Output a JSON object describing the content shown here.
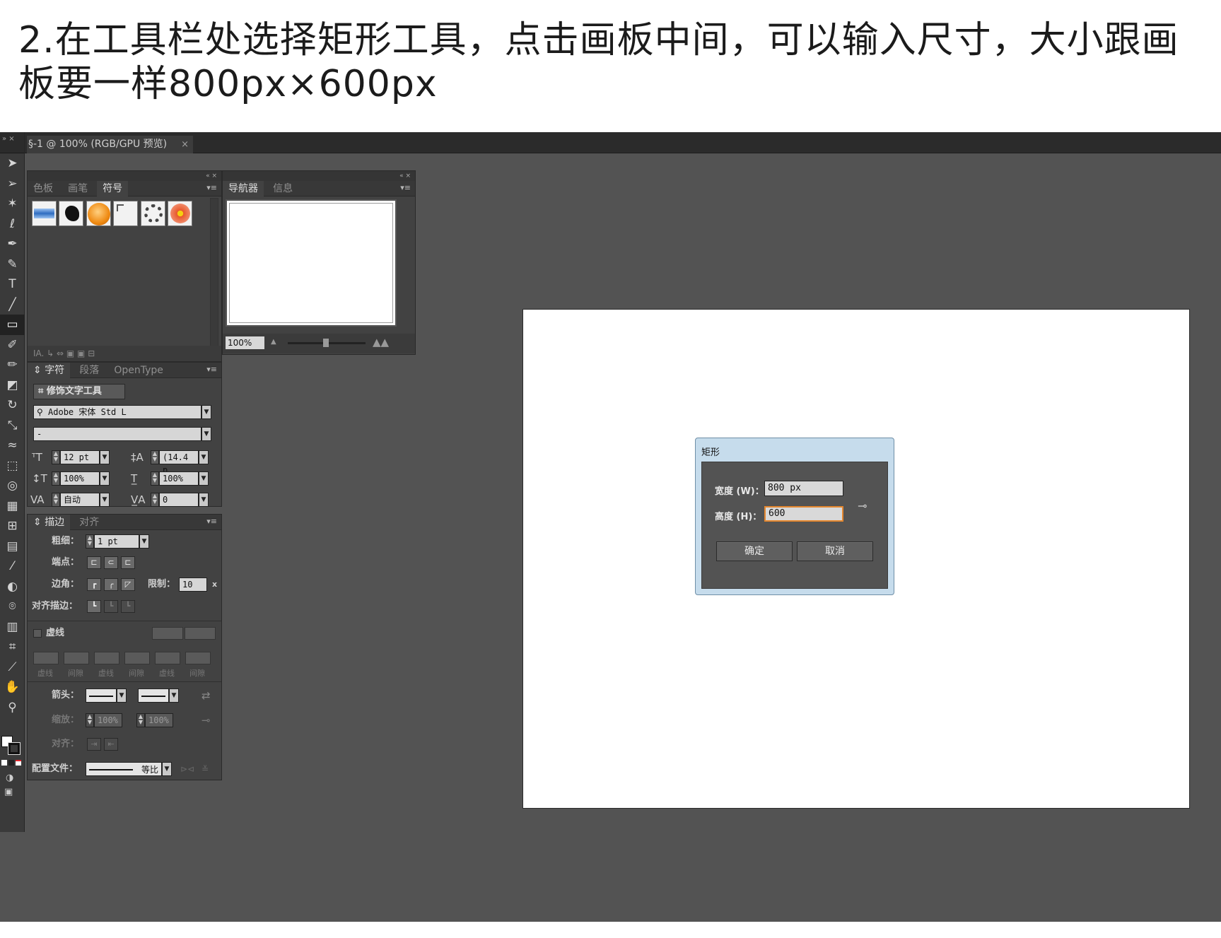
{
  "caption": {
    "line1": "2.在工具栏处选择矩形工具，点击画板中间，可以输入尺寸，大小跟画",
    "line2": "板要一样800px×600px"
  },
  "document": {
    "tab_title": "§-1 @ 100% (RGB/GPU 预览)",
    "tab_close": "×"
  },
  "tools_panel": {
    "header": "»  ×",
    "items": [
      "selection-tool",
      "direct-selection-tool",
      "magic-wand-tool",
      "lasso-tool",
      "pen-tool",
      "curvature-tool",
      "type-tool",
      "line-tool",
      "rectangle-tool",
      "paintbrush-tool",
      "pencil-tool",
      "eraser-tool",
      "rotate-tool",
      "scale-tool",
      "width-tool",
      "free-transform-tool",
      "shape-builder-tool",
      "perspective-grid-tool",
      "mesh-tool",
      "gradient-tool",
      "eyedropper-tool",
      "blend-tool",
      "symbol-sprayer-tool",
      "column-graph-tool",
      "artboard-tool",
      "slice-tool",
      "hand-tool",
      "zoom-tool"
    ],
    "selected": "rectangle-tool"
  },
  "swatch_panel": {
    "tabs": [
      "色板",
      "画笔",
      "符号"
    ],
    "active_tab": "符号",
    "menu": "▾≡",
    "footer": "IA.   ↳  ⇔  ▣  ▣  ⊟"
  },
  "navigator_panel": {
    "tabs": [
      "导航器",
      "信息"
    ],
    "active_tab": "导航器",
    "menu": "▾≡",
    "zoom": "100%"
  },
  "character_panel": {
    "tabs": [
      "字符",
      "段落",
      "OpenType"
    ],
    "active_tab": "字符",
    "menu": "▾≡",
    "touch_type_button": "修饰文字工具",
    "font_family": "Adobe 宋体 Std L",
    "font_style": "-",
    "font_size": "12 pt",
    "leading": "(14.4 p",
    "vertical_scale": "100%",
    "horizontal_scale": "100%",
    "kerning": "自动",
    "tracking": "0"
  },
  "stroke_panel": {
    "tabs": [
      "描边",
      "对齐"
    ],
    "active_tab": "描边",
    "menu": "▾≡",
    "weight_label": "粗细：",
    "weight": "1 pt",
    "cap_label": "端点：",
    "corner_label": "边角：",
    "limit_label": "限制：",
    "limit": "10",
    "limit_unit": "x",
    "align_label": "对齐描边：",
    "dashed_label": "虚线",
    "dash_labels": [
      "虚线",
      "间隙",
      "虚线",
      "间隙",
      "虚线",
      "间隙"
    ],
    "arrowheads_label": "箭头：",
    "scale_label": "缩放：",
    "scale_start": "100%",
    "scale_end": "100%",
    "align_arrows_label": "对齐：",
    "profile_label": "配置文件：",
    "profile_value": "等比"
  },
  "rectangle_dialog": {
    "title": "矩形",
    "width_label": "宽度 (W)：",
    "width_value": "800 px",
    "height_label": "高度 (H)：",
    "height_value": "600",
    "ok": "确定",
    "cancel": "取消"
  },
  "colors": {
    "workspace": "#535353",
    "panel": "#424242",
    "highlight_arrow": "#e0262b",
    "focus_ring": "#e4872f"
  }
}
